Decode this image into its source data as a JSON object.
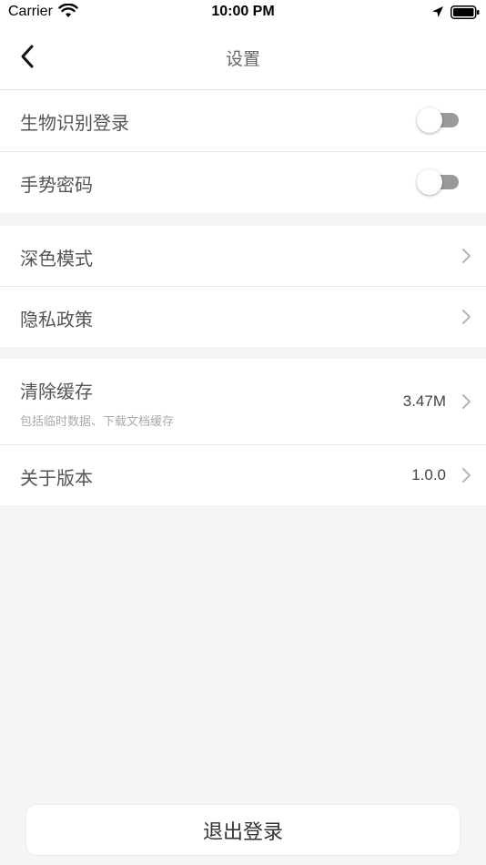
{
  "status_bar": {
    "carrier": "Carrier",
    "time": "10:00 PM",
    "icons": [
      "wifi-icon",
      "location-icon",
      "battery-icon"
    ]
  },
  "nav": {
    "title": "设置",
    "back_icon": "chevron-left-icon"
  },
  "groups": [
    {
      "rows": [
        {
          "label": "生物识别登录",
          "control": "toggle",
          "on": false
        },
        {
          "label": "手势密码",
          "control": "toggle",
          "on": false
        }
      ]
    },
    {
      "rows": [
        {
          "label": "深色模式",
          "control": "chevron"
        },
        {
          "label": "隐私政策",
          "control": "chevron"
        }
      ]
    },
    {
      "rows": [
        {
          "label": "清除缓存",
          "sublabel": "包括临时数据、下载文档缓存",
          "value": "3.47M",
          "control": "chevron"
        },
        {
          "label": "关于版本",
          "value": "1.0.0",
          "control": "chevron"
        }
      ]
    }
  ],
  "logout_label": "退出登录",
  "colors": {
    "background": "#f5f5f5",
    "card": "#ffffff",
    "toggle_off": "#9a9a9a"
  }
}
